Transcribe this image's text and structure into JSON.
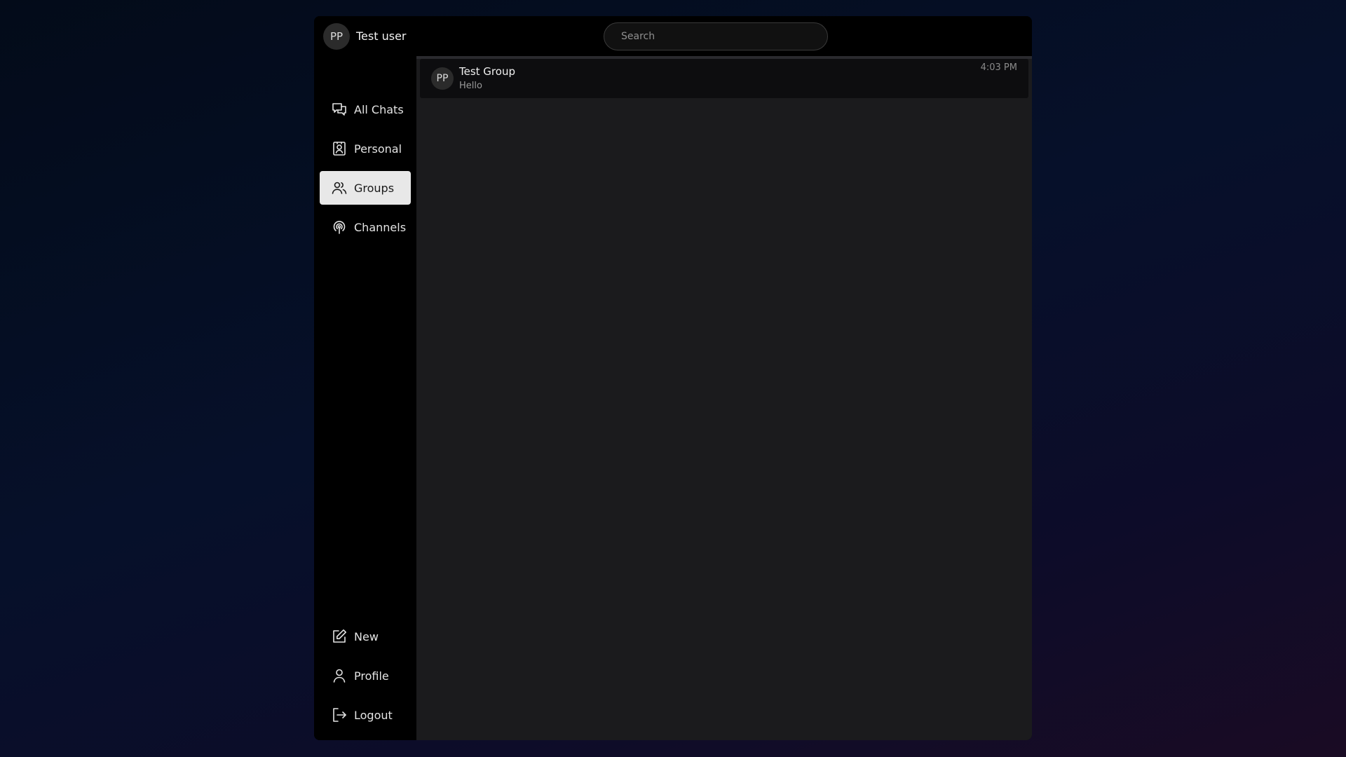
{
  "user": {
    "initials": "PP",
    "name": "Test user"
  },
  "search": {
    "placeholder": "Search",
    "value": ""
  },
  "sidebar": {
    "top_items": [
      {
        "label": "All Chats",
        "icon": "chats-icon",
        "active": false
      },
      {
        "label": "Personal",
        "icon": "contact-card-icon",
        "active": false
      },
      {
        "label": "Groups",
        "icon": "users-icon",
        "active": true
      },
      {
        "label": "Channels",
        "icon": "broadcast-icon",
        "active": false
      }
    ],
    "bottom_items": [
      {
        "label": "New",
        "icon": "edit-icon"
      },
      {
        "label": "Profile",
        "icon": "user-icon"
      },
      {
        "label": "Logout",
        "icon": "logout-icon"
      }
    ]
  },
  "chats": [
    {
      "initials": "PP",
      "title": "Test Group",
      "last_message": "Hello",
      "time": "4:03 PM"
    }
  ],
  "colors": {
    "active_nav_bg": "#e8e8e8",
    "panel_bg": "#1b1b1d",
    "sidebar_bg": "#000000"
  }
}
